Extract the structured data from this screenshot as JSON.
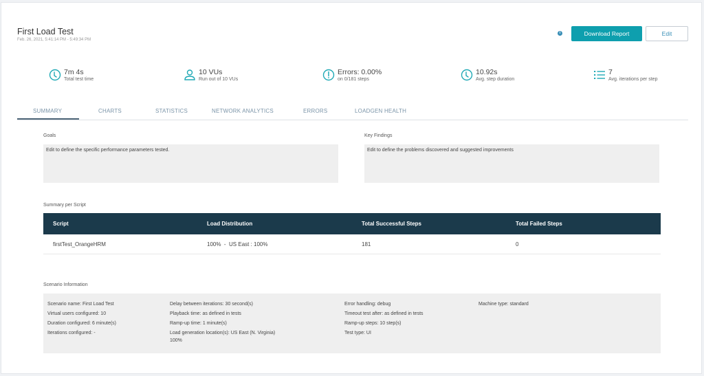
{
  "header": {
    "title": "First Load Test",
    "subtitle": "Feb. 26, 2021, 5:41:14 PM - 5:49:34 PM",
    "info_icon": "i",
    "download_button": "Download Report",
    "edit_button": "Edit"
  },
  "stats": [
    {
      "icon": "clock-icon",
      "value": "7m 4s",
      "label": "Total test time"
    },
    {
      "icon": "user-icon",
      "value": "10 VUs",
      "label": "Run out of 10 VUs"
    },
    {
      "icon": "alert-circle-icon",
      "value": "Errors: 0.00%",
      "label": "on 0/181 steps"
    },
    {
      "icon": "clock-icon",
      "value": "10.92s",
      "label": "Avg. step duration"
    },
    {
      "icon": "list-icon",
      "value": "7",
      "label": "Avg. iterations per step"
    }
  ],
  "tabs": [
    {
      "label": "SUMMARY",
      "active": true
    },
    {
      "label": "CHARTS",
      "active": false
    },
    {
      "label": "STATISTICS",
      "active": false
    },
    {
      "label": "NETWORK ANALYTICS",
      "active": false
    },
    {
      "label": "ERRORS",
      "active": false
    },
    {
      "label": "LOADGEN HEALTH",
      "active": false
    }
  ],
  "goals": {
    "label": "Goals",
    "text": "Edit to define the specific performance parameters tested."
  },
  "key_findings": {
    "label": "Key Findings",
    "text": "Edit to define the problems discovered and suggested improvements"
  },
  "summary_per_script": {
    "label": "Summary per Script",
    "columns": [
      "Script",
      "Load Distribution",
      "Total Successful Steps",
      "Total Failed Steps"
    ],
    "rows": [
      [
        "firstTest_OrangeHRM",
        "100%  -  US East : 100%",
        "181",
        "0"
      ]
    ]
  },
  "scenario": {
    "label": "Scenario Information",
    "columns": [
      [
        "Scenario name: First Load Test",
        "Virtual users configured: 10",
        "Duration configured: 6 minute(s)",
        "Iterations configured: -"
      ],
      [
        "Delay between iterations: 30 second(s)",
        "Playback time: as defined in tests",
        "Ramp-up time: 1 minute(s)",
        "Load generation location(s): US East (N. Virginia)",
        "100%"
      ],
      [
        "Error handling: debug",
        "Timeout test after: as defined in tests",
        "Ramp-up steps: 10 step(s)",
        "Test type: UI"
      ],
      [
        "Machine type: standard"
      ]
    ]
  },
  "colors": {
    "accent": "#0e9fae",
    "icon": "#1fa9b5",
    "table_header": "#1b3a4b",
    "tab_text": "#7a94a8"
  }
}
